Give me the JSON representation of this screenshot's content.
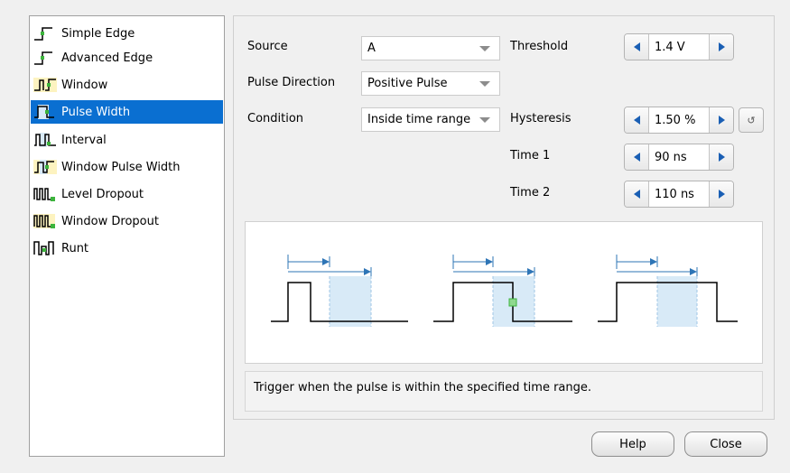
{
  "sidebar": {
    "items": [
      {
        "label": "Simple Edge",
        "icon": "simple-edge-icon",
        "selected": false
      },
      {
        "label": "Advanced Edge",
        "icon": "advanced-edge-icon",
        "selected": false
      },
      {
        "label": "Window",
        "icon": "window-icon",
        "selected": false
      },
      {
        "label": "Pulse Width",
        "icon": "pulse-width-icon",
        "selected": true
      },
      {
        "label": "Interval",
        "icon": "interval-icon",
        "selected": false
      },
      {
        "label": "Window Pulse Width",
        "icon": "window-pulse-width-icon",
        "selected": false
      },
      {
        "label": "Level Dropout",
        "icon": "level-dropout-icon",
        "selected": false
      },
      {
        "label": "Window Dropout",
        "icon": "window-dropout-icon",
        "selected": false
      },
      {
        "label": "Runt",
        "icon": "runt-icon",
        "selected": false
      }
    ]
  },
  "settings": {
    "source_label": "Source",
    "source_value": "A",
    "pulse_direction_label": "Pulse Direction",
    "pulse_direction_value": "Positive Pulse",
    "condition_label": "Condition",
    "condition_value": "Inside time range",
    "threshold_label": "Threshold",
    "threshold_value": "1.4 V",
    "hysteresis_label": "Hysteresis",
    "hysteresis_value": "1.50 %",
    "time1_label": "Time 1",
    "time1_value": "90 ns",
    "time2_label": "Time 2",
    "time2_value": "110 ns"
  },
  "description": "Trigger when the pulse is within the specified time range.",
  "buttons": {
    "help": "Help",
    "close": "Close"
  },
  "colors": {
    "selection": "#0a6fd1",
    "spinner_arrow": "#1a5fb4",
    "diagram_line": "#2e75b6",
    "window_fill": "#d8eaf7",
    "trigger_point": "#3cb43c"
  }
}
